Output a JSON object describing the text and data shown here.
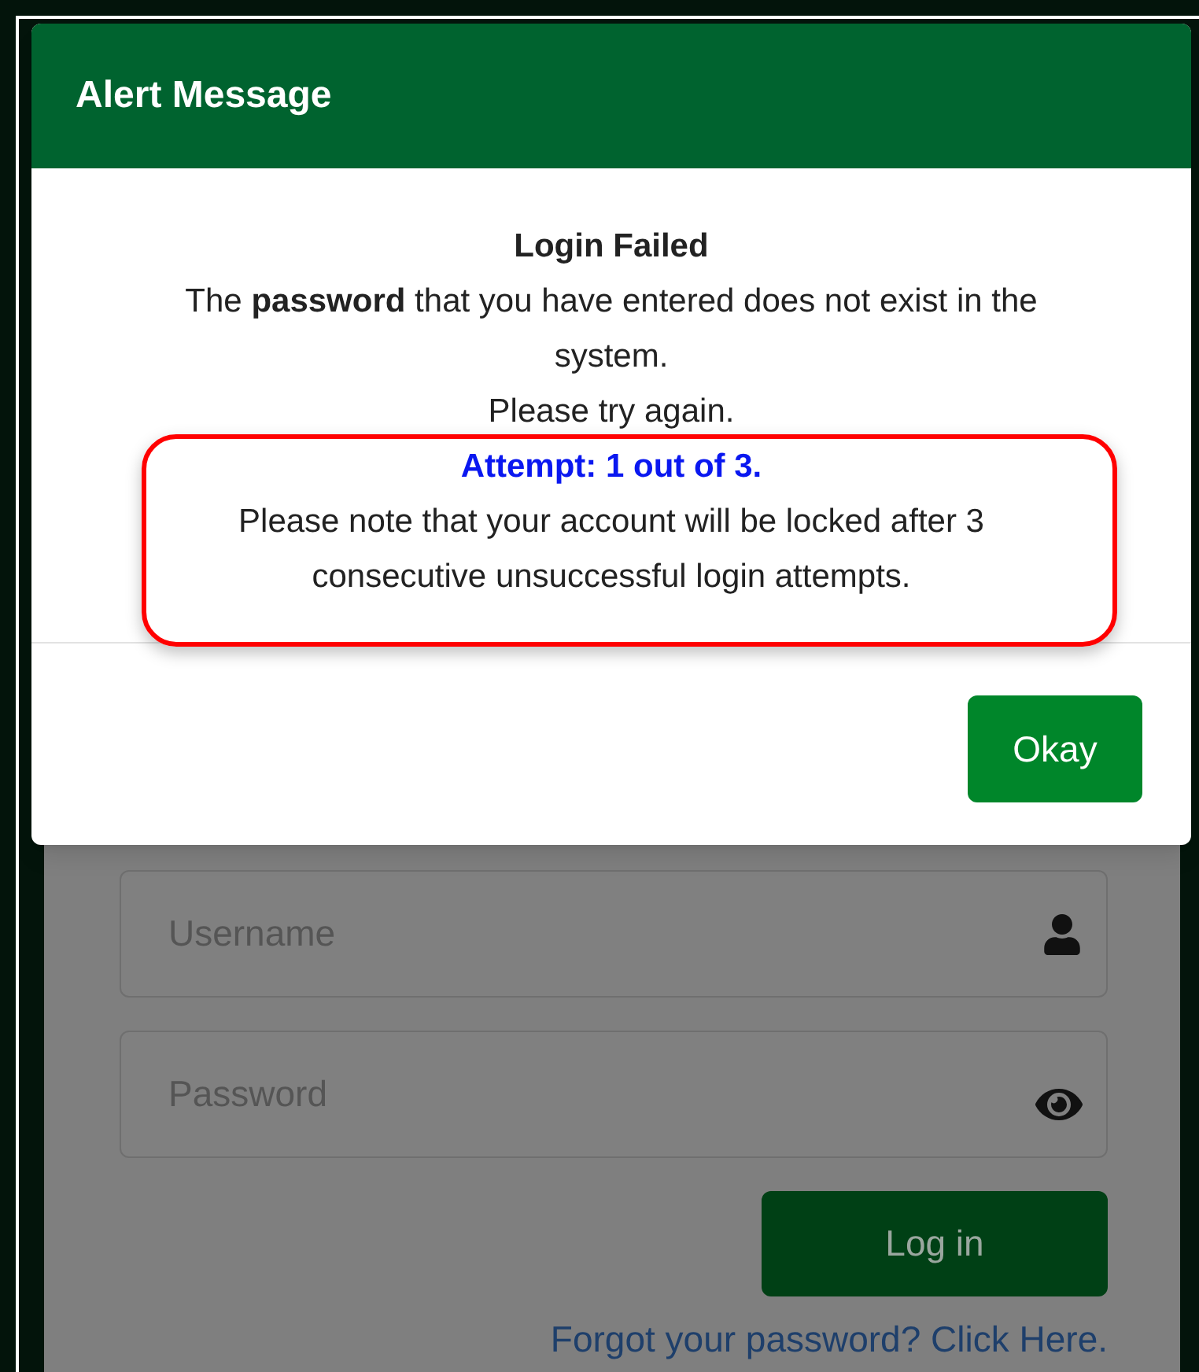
{
  "modal": {
    "title": "Alert Message",
    "heading": "Login Failed",
    "message": "The **password** that you have entered does not exist in the system.",
    "retry": "Please try again.",
    "attempt": "Attempt: 1 out of 3.",
    "notice": "Please note that your account will be locked after 3 consecutive unsuccessful login attempts.",
    "button": "Okay"
  },
  "login": {
    "fields": [
      {
        "kind": "username",
        "placeholder": "Username"
      },
      {
        "kind": "password",
        "placeholder": "Password"
      }
    ],
    "button": "Log in",
    "link": "Forgot your password? Click Here."
  }
}
